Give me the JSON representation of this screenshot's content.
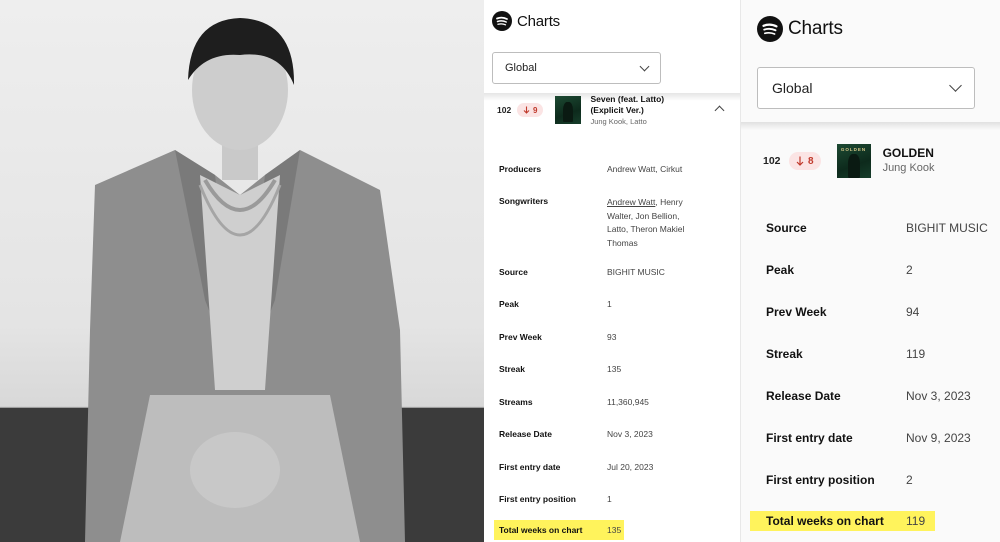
{
  "photo": {
    "alt": ""
  },
  "mid_panel": {
    "brand": "Charts",
    "region": "Global",
    "track": {
      "rank": "102",
      "movement": "9",
      "title_line1": "Seven (feat. Latto)",
      "title_line2": "(Explicit Ver.)",
      "artist": "Jung Kook, Latto"
    },
    "details": [
      {
        "label": "Producers",
        "value": "Andrew Watt, Cirkut"
      },
      {
        "label": "Songwriters",
        "value_link": "Andrew Watt",
        "value_rest": ", Henry",
        "value_lines": [
          "Walter, Jon Bellion,",
          "Latto, Theron Makiel",
          "Thomas"
        ]
      },
      {
        "label": "Source",
        "value": "BIGHIT MUSIC"
      },
      {
        "label": "Peak",
        "value": "1"
      },
      {
        "label": "Prev Week",
        "value": "93"
      },
      {
        "label": "Streak",
        "value": "135"
      },
      {
        "label": "Streams",
        "value": "11,360,945"
      },
      {
        "label": "Release Date",
        "value": "Nov 3, 2023"
      },
      {
        "label": "First entry date",
        "value": "Jul 20, 2023"
      },
      {
        "label": "First entry position",
        "value": "1"
      },
      {
        "label": "Total weeks on chart",
        "value": "135"
      }
    ]
  },
  "right_panel": {
    "brand": "Charts",
    "region": "Global",
    "track": {
      "rank": "102",
      "movement": "8",
      "art_text": "GOLDEN",
      "title": "GOLDEN",
      "artist": "Jung Kook"
    },
    "details": [
      {
        "label": "Source",
        "value": "BIGHIT MUSIC"
      },
      {
        "label": "Peak",
        "value": "2"
      },
      {
        "label": "Prev Week",
        "value": "94"
      },
      {
        "label": "Streak",
        "value": "119"
      },
      {
        "label": "Release Date",
        "value": "Nov 3, 2023"
      },
      {
        "label": "First entry date",
        "value": "Nov 9, 2023"
      },
      {
        "label": "First entry position",
        "value": "2"
      },
      {
        "label": "Total weeks on chart",
        "value": "119"
      }
    ]
  },
  "colors": {
    "movement_down": "#c0392b",
    "movement_bg": "#fbe4e4",
    "highlight": "#fff35c"
  },
  "icons": [
    "spotify-icon",
    "chevron-down-icon",
    "arrow-down-icon",
    "chevron-up-icon"
  ]
}
